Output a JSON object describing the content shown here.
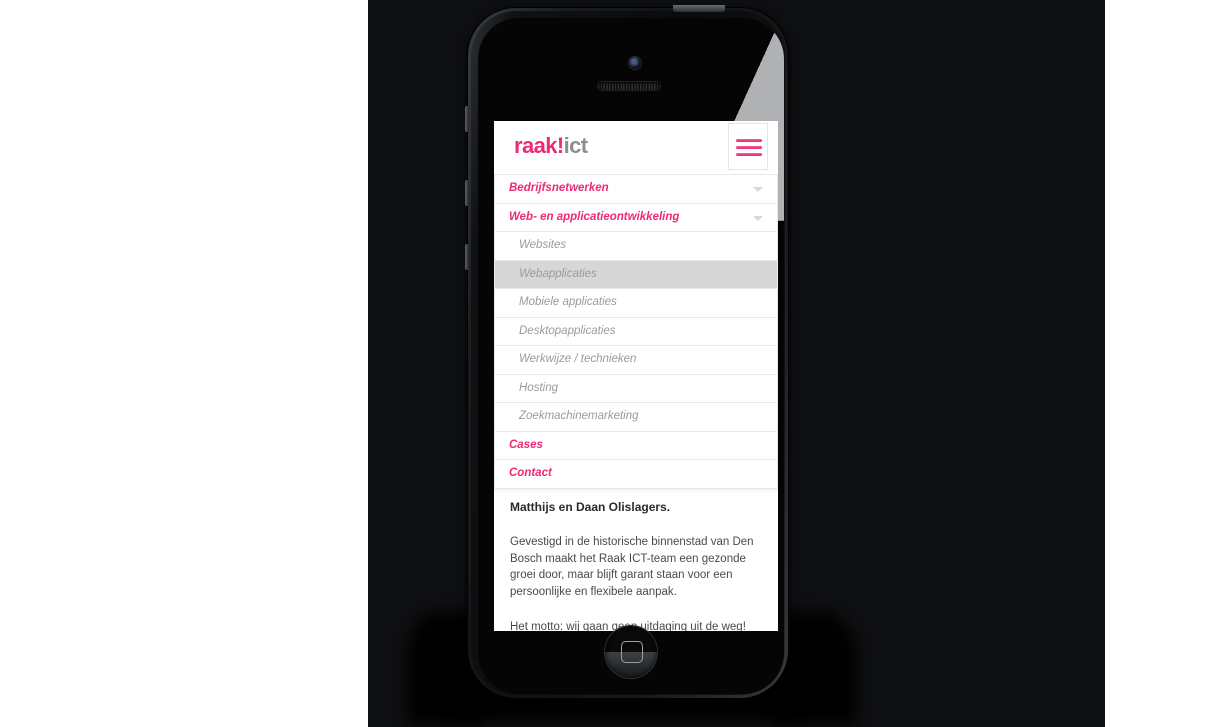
{
  "page": {
    "background": "#ffffff",
    "panel_color": "#0e0f11"
  },
  "device": {
    "name": "smartphone-mockup",
    "color": "#101113",
    "hardware": {
      "power_button": "power-button",
      "camera": "front-camera",
      "speaker": "earpiece-speaker",
      "silent_switch": "silent-switch",
      "volume_up": "volume-up-button",
      "volume_down": "volume-down-button",
      "home_button": "home-button"
    }
  },
  "site": {
    "logo": {
      "brand": "raak!",
      "suffix": "ict",
      "brand_color": "#ec2a75",
      "suffix_color": "#8e8e8e"
    },
    "menu_toggle": {
      "name": "hamburger-menu-button",
      "bar_color": "#ec2a75"
    },
    "nav": [
      {
        "label": "Bedrijfsnetwerken",
        "kind": "top",
        "has_caret": true,
        "active": false
      },
      {
        "label": "Web- en applicatieontwikkeling",
        "kind": "top",
        "has_caret": true,
        "active": true
      },
      {
        "label": "Websites",
        "kind": "sub",
        "has_caret": false,
        "active": false
      },
      {
        "label": "Webapplicaties",
        "kind": "sub",
        "has_caret": false,
        "active": true
      },
      {
        "label": "Mobiele applicaties",
        "kind": "sub",
        "has_caret": false,
        "active": false
      },
      {
        "label": "Desktopapplicaties",
        "kind": "sub",
        "has_caret": false,
        "active": false
      },
      {
        "label": "Werkwijze / technieken",
        "kind": "sub",
        "has_caret": false,
        "active": false
      },
      {
        "label": "Hosting",
        "kind": "sub",
        "has_caret": false,
        "active": false
      },
      {
        "label": "Zoekmachinemarketing",
        "kind": "sub",
        "has_caret": false,
        "active": false
      },
      {
        "label": "Cases",
        "kind": "link",
        "has_caret": false,
        "active": false
      },
      {
        "label": "Contact",
        "kind": "link",
        "has_caret": false,
        "active": false
      }
    ],
    "content": {
      "lead": "Matthijs en Daan Olislagers.",
      "paragraph_1": "Gevestigd in de historische binnenstad van Den Bosch maakt het Raak ICT-team een gezonde groei door, maar blijft garant staan voor een persoonlijke en flexibele aanpak.",
      "paragraph_2": "Het motto: wij gaan geen uitdaging uit de weg!"
    }
  }
}
